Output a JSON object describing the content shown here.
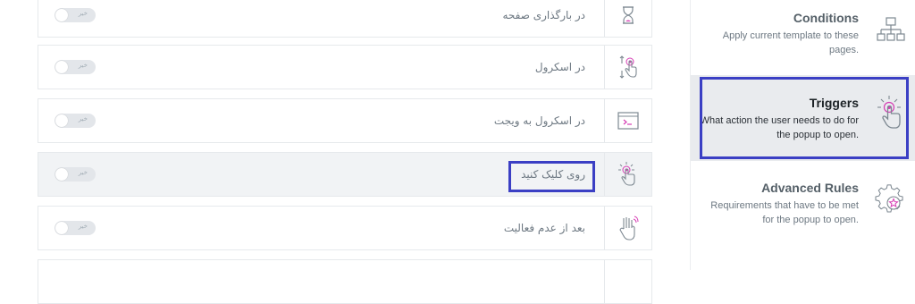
{
  "triggers": [
    {
      "label": "در بارگذاری صفحه",
      "icon": "hourglass-icon",
      "toggle": "خیر",
      "active": false
    },
    {
      "label": "در اسکرول",
      "icon": "scroll-hand-icon",
      "toggle": "خیر",
      "active": false
    },
    {
      "label": "در اسکرول به ویجت",
      "icon": "widget-code-icon",
      "toggle": "خیر",
      "active": false
    },
    {
      "label": "روی کلیک کنید",
      "icon": "click-hand-icon",
      "toggle": "خیر",
      "active": true
    },
    {
      "label": "بعد از عدم فعالیت",
      "icon": "inactivity-hand-icon",
      "toggle": "خیر",
      "active": false
    }
  ],
  "sidebar": {
    "items": [
      {
        "title": "Conditions",
        "desc": "Apply current template to these pages.",
        "icon": "sitemap-icon"
      },
      {
        "title": "Triggers",
        "desc": "What action the user needs to do for the popup to open.",
        "icon": "click-hand-icon"
      },
      {
        "title": "Advanced Rules",
        "desc": "Requirements that have to be met for the popup to open.",
        "icon": "gear-star-icon"
      }
    ]
  },
  "colors": {
    "accent": "#d63cb4",
    "highlight": "#3b3fc4",
    "border": "#e6e9ec",
    "text": "#6d7882"
  }
}
